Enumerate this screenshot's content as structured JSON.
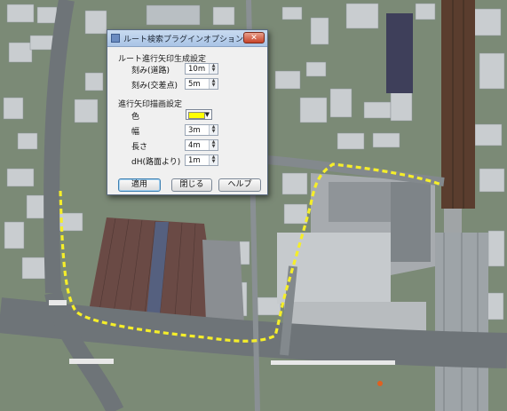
{
  "dialog": {
    "title": "ルート検索プラグインオプション",
    "close_label": "✕",
    "section_generation": "ルート進行矢印生成設定",
    "spacing_road_label": "刻み(道路)",
    "spacing_road_value": "10m",
    "spacing_intersection_label": "刻み(交差点)",
    "spacing_intersection_value": "5m",
    "section_drawing": "進行矢印描画設定",
    "color_label": "色",
    "color_value": "#ffff00",
    "width_label": "幅",
    "width_value": "3m",
    "length_label": "長さ",
    "length_value": "4m",
    "height_label": "dH(路面より)",
    "height_value": "1m",
    "apply_button": "適用",
    "close_button": "閉じる",
    "help_button": "ヘルプ"
  },
  "colors": {
    "route": "#f5ee2a",
    "road": "#6e7478",
    "rail": "#5a3d2e",
    "roof_brown": "#6a4a45"
  }
}
